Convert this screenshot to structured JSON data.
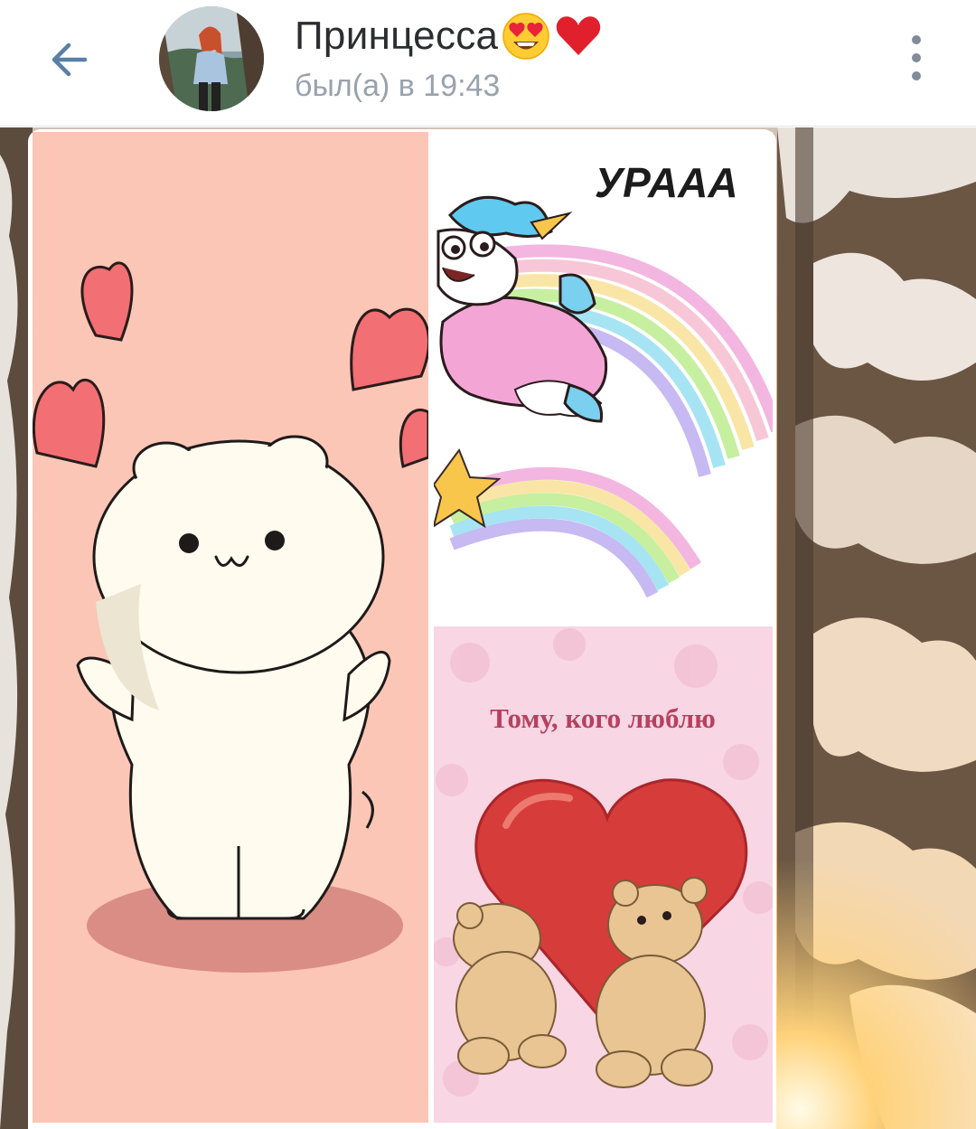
{
  "header": {
    "contact_name": "Принцесса",
    "name_emojis": [
      "smiling-face-with-heart-eyes",
      "red-heart"
    ],
    "last_seen": "был(а) в 19:43"
  },
  "icons": {
    "back": "arrow-left-icon",
    "more": "vertical-dots-icon"
  },
  "chat": {
    "attachments": [
      {
        "type": "image",
        "subject": "white bear with hearts",
        "background": "#fcc6b6"
      },
      {
        "type": "image",
        "subject": "unicorn riding rainbow",
        "caption": "УРААА"
      },
      {
        "type": "image",
        "subject": "teddy bears holding heart",
        "caption": "Тому, кого люблю"
      }
    ]
  },
  "colors": {
    "header_bg": "#ffffff",
    "title_text": "#2c2d2e",
    "subtitle_text": "#99a2ad",
    "icon_color": "#5a7fa7",
    "more_icon_color": "#818c99"
  }
}
